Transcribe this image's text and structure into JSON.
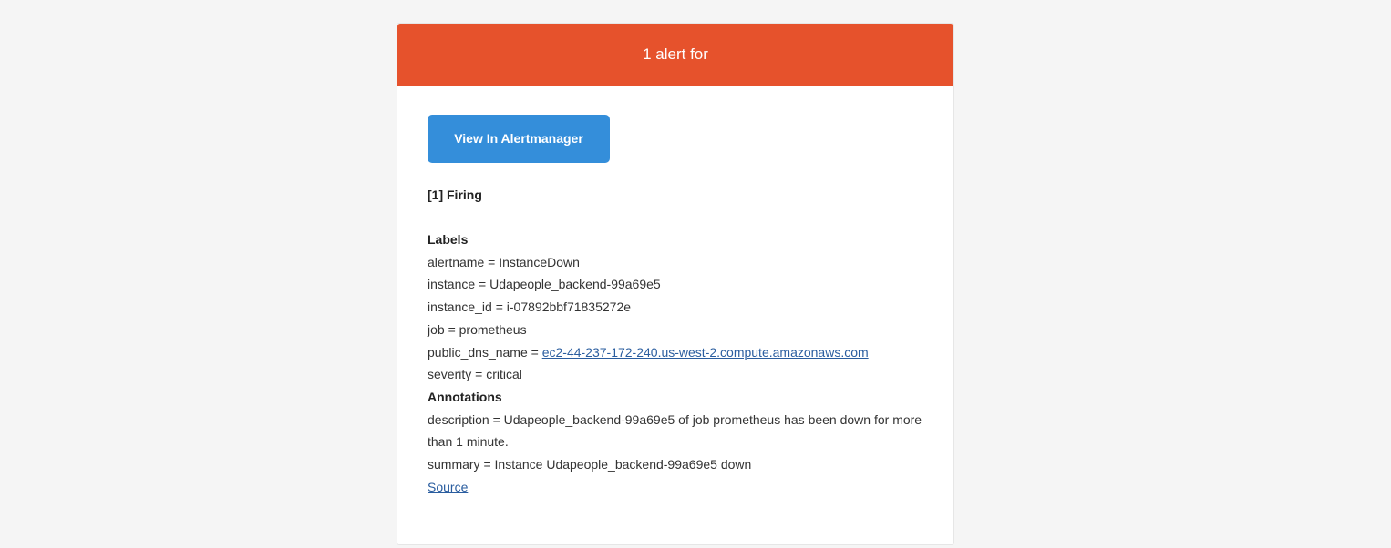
{
  "header": {
    "title": "1 alert for"
  },
  "button": {
    "label": "View In Alertmanager"
  },
  "status": {
    "heading": "[1] Firing"
  },
  "labels": {
    "title": "Labels",
    "alertname": "alertname = InstanceDown",
    "instance": "instance = Udapeople_backend-99a69e5",
    "instance_id": "instance_id = i-07892bbf71835272e",
    "job": "job = prometheus",
    "public_dns_name_key": "public_dns_name = ",
    "public_dns_name_value": "ec2-44-237-172-240.us-west-2.compute.amazonaws.com",
    "severity": "severity = critical"
  },
  "annotations": {
    "title": "Annotations",
    "description": "description = Udapeople_backend-99a69e5 of job prometheus has been down for more than 1 minute.",
    "summary": "summary = Instance Udapeople_backend-99a69e5 down"
  },
  "source": {
    "label": "Source"
  },
  "colors": {
    "header_bg": "#e6522c",
    "button_bg": "#348eda",
    "link": "#2a5d9f",
    "page_bg": "#f5f5f5"
  }
}
